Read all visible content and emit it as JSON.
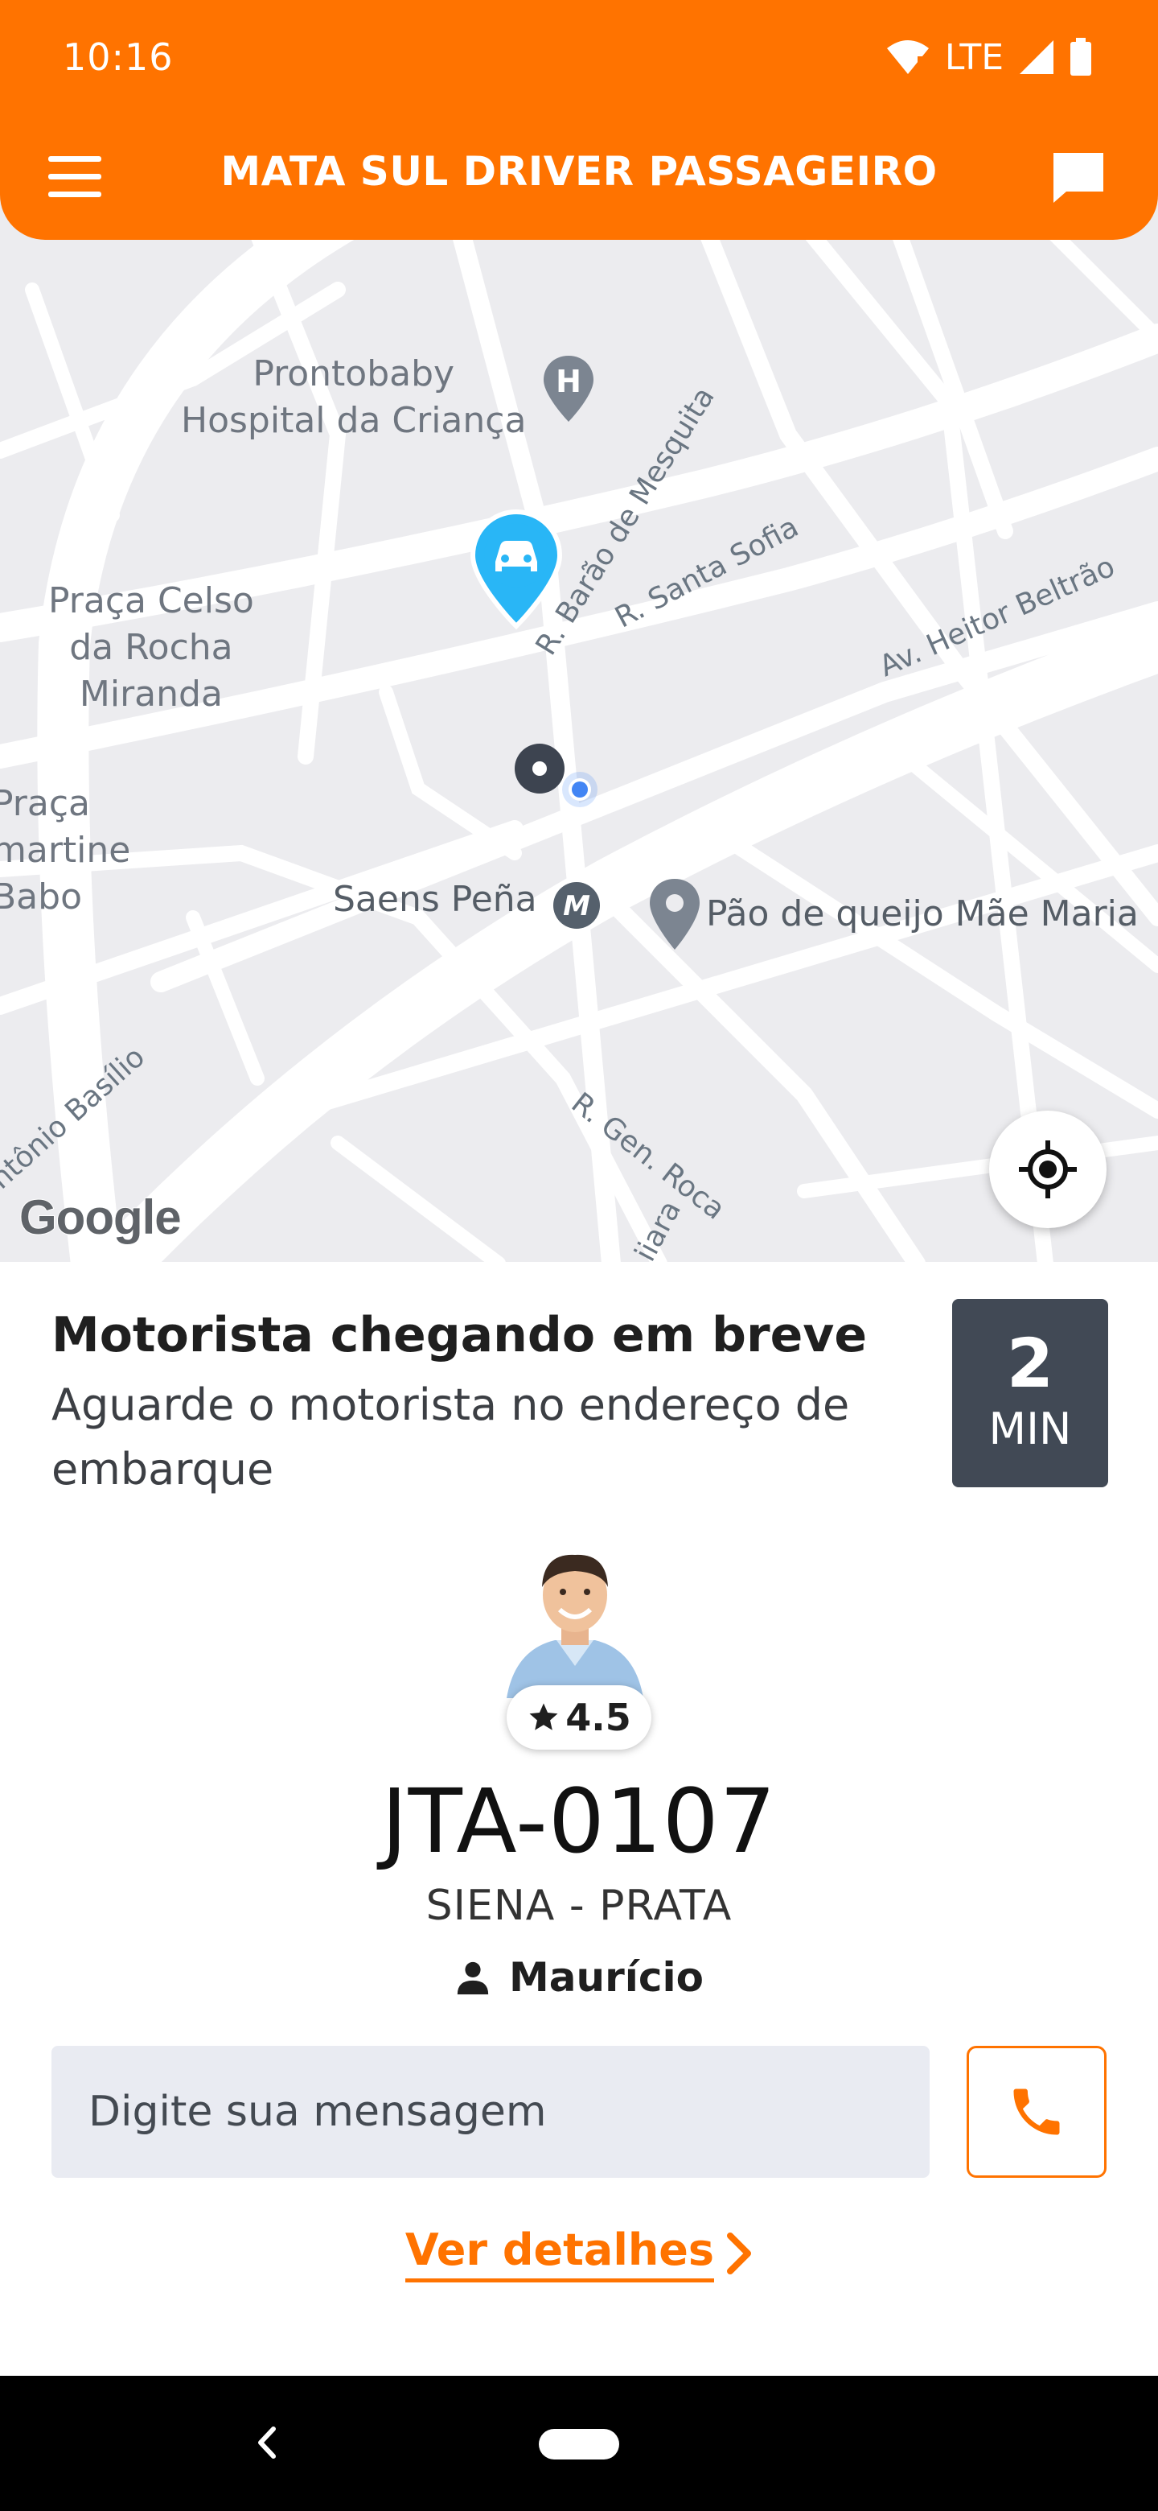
{
  "status_bar": {
    "time": "10:16",
    "network": "LTE"
  },
  "header": {
    "title": "MATA SUL DRIVER PASSAGEIRO",
    "menu_icon": "hamburger-menu-icon",
    "chat_icon": "chat-icon"
  },
  "map": {
    "places": {
      "hospital": [
        "Prontobaby",
        "Hospital da Criança"
      ],
      "praca_celso": [
        "Praça Celso",
        "da Rocha",
        "Miranda"
      ],
      "praca_lamartine": [
        "Praça",
        "martine",
        "Babo"
      ],
      "metro": "Saens Peña",
      "pao_de_queijo": "Pão de queijo Mãe Maria"
    },
    "streets": {
      "barao": "R. Barão de Mesquita",
      "santa_sofia": "R. Santa Sofia",
      "heitor": "Av. Heitor Beltrão",
      "gen_roca": "R. Gen. Roca",
      "antonio": "ntônio Basílio",
      "jiara": "iiara"
    },
    "attribution": "Google",
    "colors": {
      "background": "#ececef",
      "roads": "#ffffff",
      "driver_pin": "#29b6f6",
      "user_dot": "#4285f4"
    }
  },
  "trip": {
    "title": "Motorista chegando em breve",
    "subtitle": "Aguarde o motorista no endereço de embarque",
    "eta_value": "2",
    "eta_unit": "MIN"
  },
  "driver": {
    "rating": "4.5",
    "plate": "JTA-0107",
    "car": "SIENA - PRATA",
    "name": "Maurício"
  },
  "message": {
    "placeholder": "Digite sua mensagem"
  },
  "details_link": "Ver detalhes",
  "colors": {
    "accent": "#ff7300",
    "eta_box": "#414955",
    "input_bg": "#e9ebf2"
  }
}
